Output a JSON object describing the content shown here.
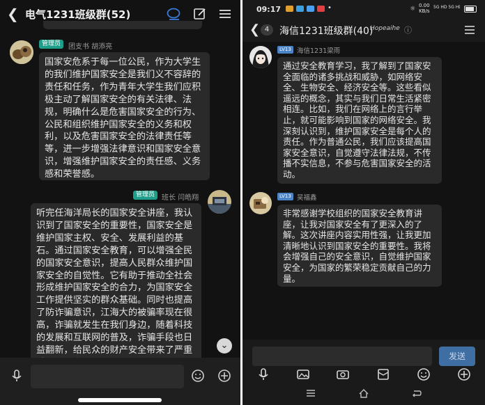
{
  "left": {
    "header": {
      "title": "电气1231班级群(52)"
    },
    "messages": [
      {
        "badge": "管理员",
        "sender": "团支书  胡添亮",
        "text": "国家安危系于每一位公民，作为大学生的我们维护国家安全是我们义不容辞的责任和任务，作为青年大学生我们应积极主动了解国家安全的有关法律、法规，明确什么是危害国家安全的行为、公民和组织维护国家安全的义务和权利，以及危害国家安全的法律责任等等，进一步增强法律意识和国家安全意识，增强维护国家安全的责任感、义务感和荣誉感。"
      },
      {
        "badge": "管理员",
        "sender": "班长  闫皓翔",
        "text": "听完任海洋局长的国家安全讲座，我认识到了国家安全的重要性，国家安全是维护国家主权、安全、发展利益的基石。通过国家安全教育，可以增强全民的国家安全意识，提高人民群众维护国家安全的自觉性。它有助于推动全社会形成维护国家安全的合力，为国家安全工作提供坚实的群众基础。同时也提高了防诈骗意识，江海大的被骗率现在很高，诈骗就发生在我们身边，随着科技的发展和互联网的普及，诈骗手段也日益翻新，给民众的财产安全带来了严重威胁。防止"
      }
    ]
  },
  "right": {
    "status": {
      "time": "09:17",
      "speed_value": "0.00",
      "speed_unit": "KB/s",
      "network": "5G HD 5G HD"
    },
    "header": {
      "count": "4",
      "title": "海信1231班级群(40)",
      "signature": "Hopeaihe"
    },
    "messages": [
      {
        "level": "LV13",
        "sender": "海信1231梁雨",
        "text": "通过安全教育学习，我了解到了国家安全面临的诸多挑战和威胁，如网络安全、生物安全、经济安全等。这些看似遥远的概念，其实与我们日常生活紧密相连。比如，我们在网络上的言行举止，就可能影响到国家的网络安全。我深刻认识到，维护国家安全是每个人的责任。作为普通公民，我们应该提高国家安全意识，自觉遵守法律法规，不传播不实信息，不参与危害国家安全的活动。"
      },
      {
        "level": "LV13",
        "sender": "吴福鑫",
        "text": "非常感谢学校组织的国家安全教育讲座，让我对国家安全有了更深入的了解。这次讲座内容实用性强，让我更加清晰地认识到国家安全的重要性。我将会增强自己的安全意识，自觉维护国家安全，为国家的繁荣稳定贡献自己的力量。"
      }
    ],
    "input": {
      "send_label": "发送"
    }
  },
  "icons": {
    "back": "chevron-left-icon",
    "chat": "chat-bubble-icon",
    "edit": "edit-square-icon",
    "menu": "menu-icon",
    "voice": "microphone-icon",
    "emoji": "emoji-icon",
    "add": "plus-circle-icon",
    "image": "image-icon",
    "camera": "camera-icon",
    "envelope": "red-packet-icon",
    "down": "chevron-down-icon"
  },
  "colors": {
    "background": "#121212",
    "bubble": "#2a2a2a",
    "admin_badge": "#1e9e8a",
    "level_badge": "#4c84c8",
    "accent": "#3b7bd8",
    "send_button": "#3f6ea2"
  }
}
